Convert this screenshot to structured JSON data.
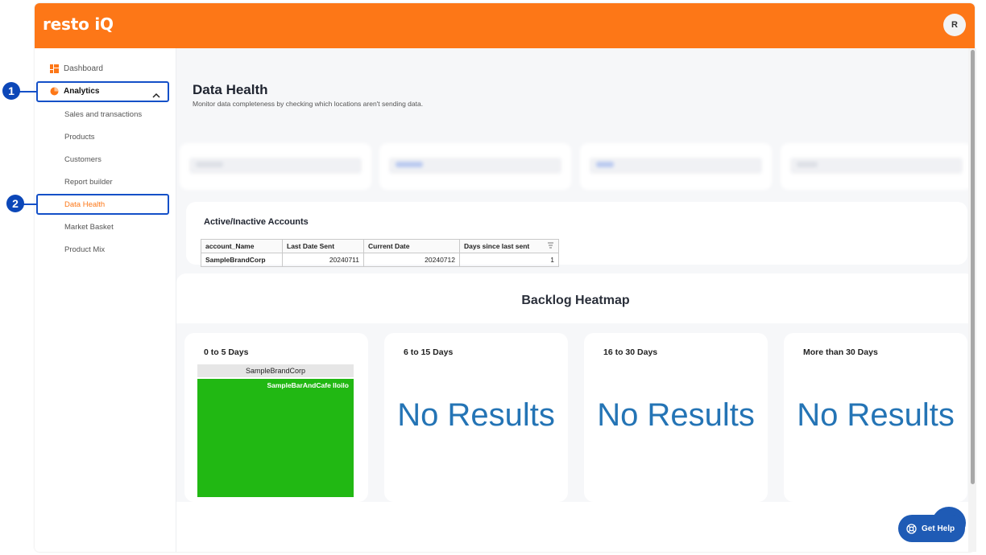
{
  "app": {
    "logo": "resto iQ",
    "avatar_initial": "R"
  },
  "colors": {
    "brand": "#fd7717",
    "active_nav": "#fd7717",
    "highlight": "#1450c8",
    "heat_green": "#21b813",
    "no_results": "#2474b5"
  },
  "sidebar": {
    "dashboard": "Dashboard",
    "analytics": "Analytics",
    "items": [
      "Sales and transactions",
      "Products",
      "Customers",
      "Report builder",
      "Data Health",
      "Market Basket",
      "Product Mix"
    ]
  },
  "annotations": {
    "badge1": "1",
    "badge2": "2"
  },
  "page": {
    "title": "Data Health",
    "subtitle": "Monitor data completeness by checking which locations aren't sending data."
  },
  "accounts": {
    "title": "Active/Inactive Accounts",
    "columns": [
      "account_Name",
      "Last Date Sent",
      "Current Date",
      "Days since last sent"
    ],
    "rows": [
      [
        "SampleBrandCorp",
        "20240711",
        "20240712",
        "1"
      ]
    ]
  },
  "heatmap": {
    "title": "Backlog Heatmap",
    "buckets": [
      "0 to 5 Days",
      "6 to 15 Days",
      "16 to 30 Days",
      "More than 30 Days"
    ],
    "no_results": "No Results",
    "tree_header": "SampleBrandCorp",
    "tree_cell": "SampleBarAndCafe Iloilo"
  },
  "help": {
    "label": "Get Help"
  }
}
